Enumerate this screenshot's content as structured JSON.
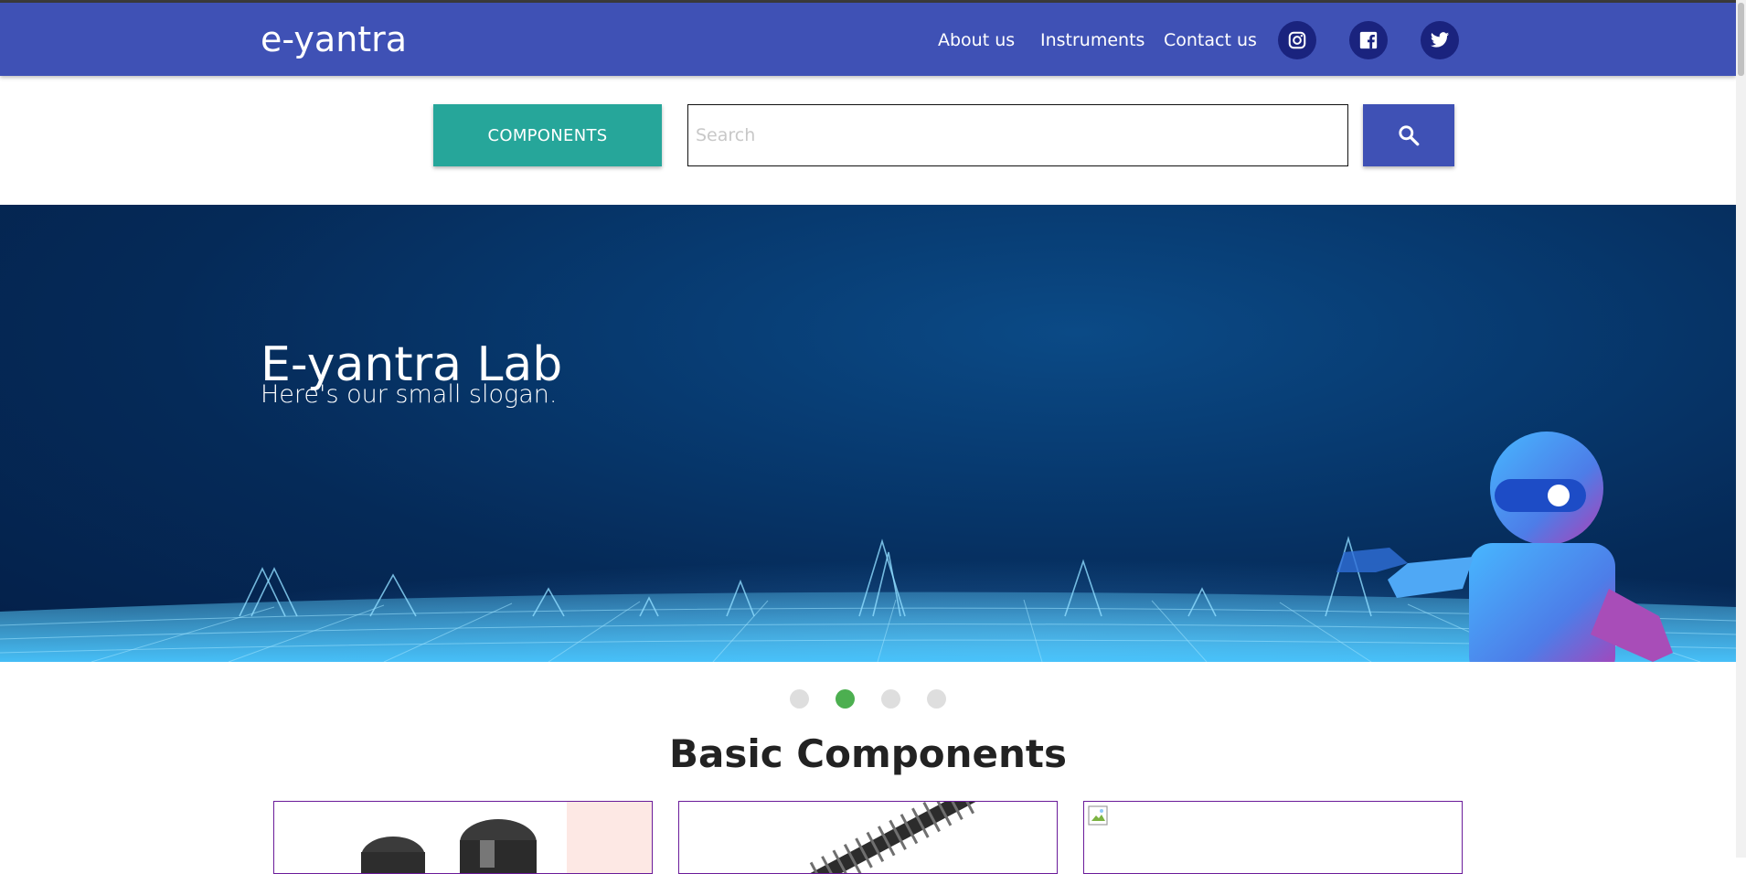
{
  "header": {
    "brand": "e-yantra",
    "nav": [
      {
        "label": "About us"
      },
      {
        "label": "Instruments"
      },
      {
        "label": "Contact us"
      }
    ],
    "social": [
      "instagram-icon",
      "facebook-icon",
      "twitter-icon"
    ]
  },
  "search": {
    "category_label": "COMPONENTS",
    "placeholder": "Search",
    "value": "",
    "button_icon": "search-icon"
  },
  "hero": {
    "title": "E-yantra Lab",
    "slogan": "Here's our small slogan."
  },
  "carousel": {
    "count": 4,
    "active_index": 1
  },
  "section": {
    "title": "Basic Components"
  },
  "colors": {
    "primary": "#3f51b5",
    "accent": "#26a69a",
    "active_dot": "#4caf50",
    "card_border": "#6a1b9a"
  }
}
